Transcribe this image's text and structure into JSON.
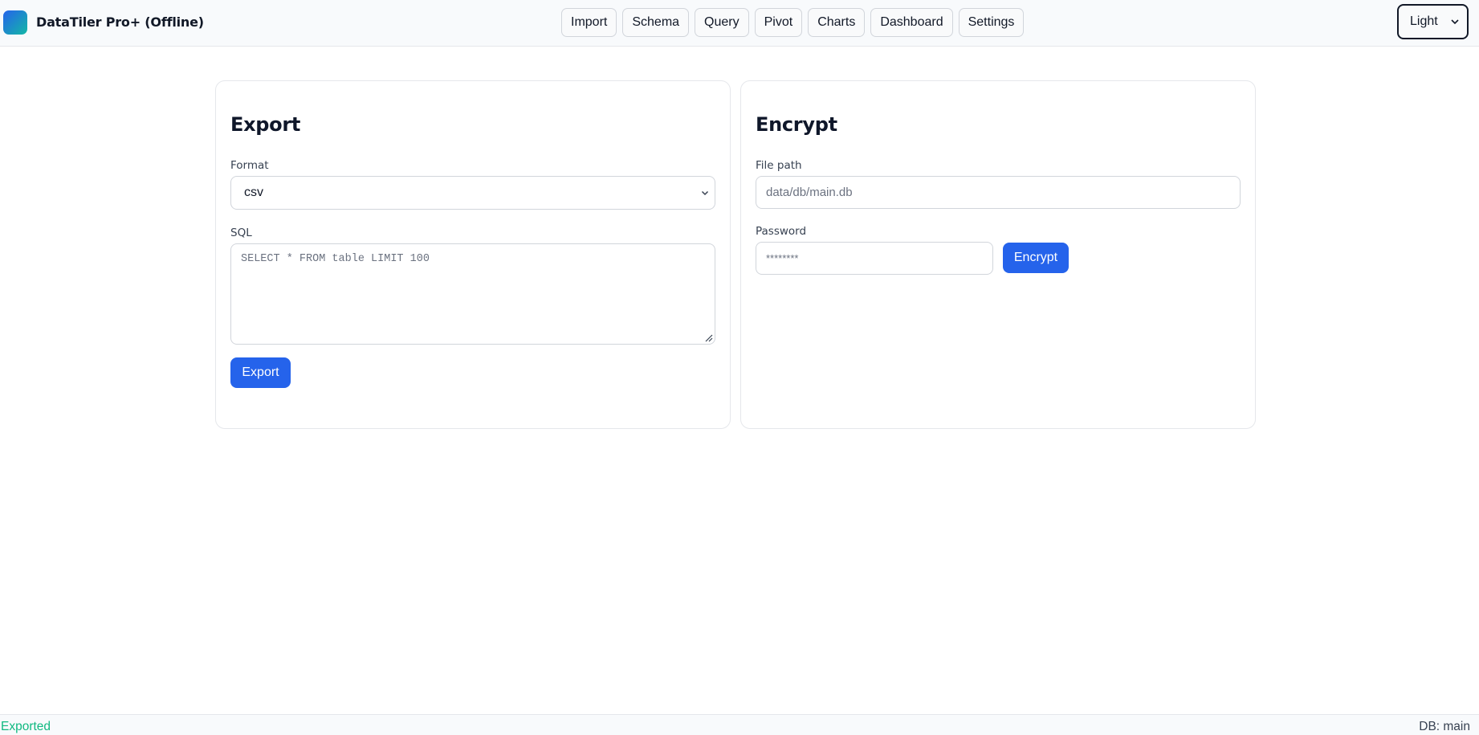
{
  "app": {
    "title": "DataTiler Pro+ (Offline)"
  },
  "nav": {
    "items": [
      {
        "label": "Import"
      },
      {
        "label": "Schema"
      },
      {
        "label": "Query"
      },
      {
        "label": "Pivot"
      },
      {
        "label": "Charts"
      },
      {
        "label": "Dashboard"
      },
      {
        "label": "Settings"
      }
    ]
  },
  "theme": {
    "selected": "Light"
  },
  "export": {
    "title": "Export",
    "format_label": "Format",
    "format_value": "csv",
    "sql_label": "SQL",
    "sql_placeholder": "SELECT * FROM table LIMIT 100",
    "button_label": "Export"
  },
  "encrypt": {
    "title": "Encrypt",
    "path_label": "File path",
    "path_placeholder": "data/db/main.db",
    "password_label": "Password",
    "password_placeholder": "********",
    "button_label": "Encrypt"
  },
  "status": {
    "message": "Exported",
    "db": "DB: main"
  },
  "colors": {
    "accent": "#2563eb",
    "success": "#10b981"
  },
  "icons": {
    "logo": "app-logo-icon",
    "select_chevron": "chevron-down-icon",
    "resize": "resize-grip-icon"
  }
}
